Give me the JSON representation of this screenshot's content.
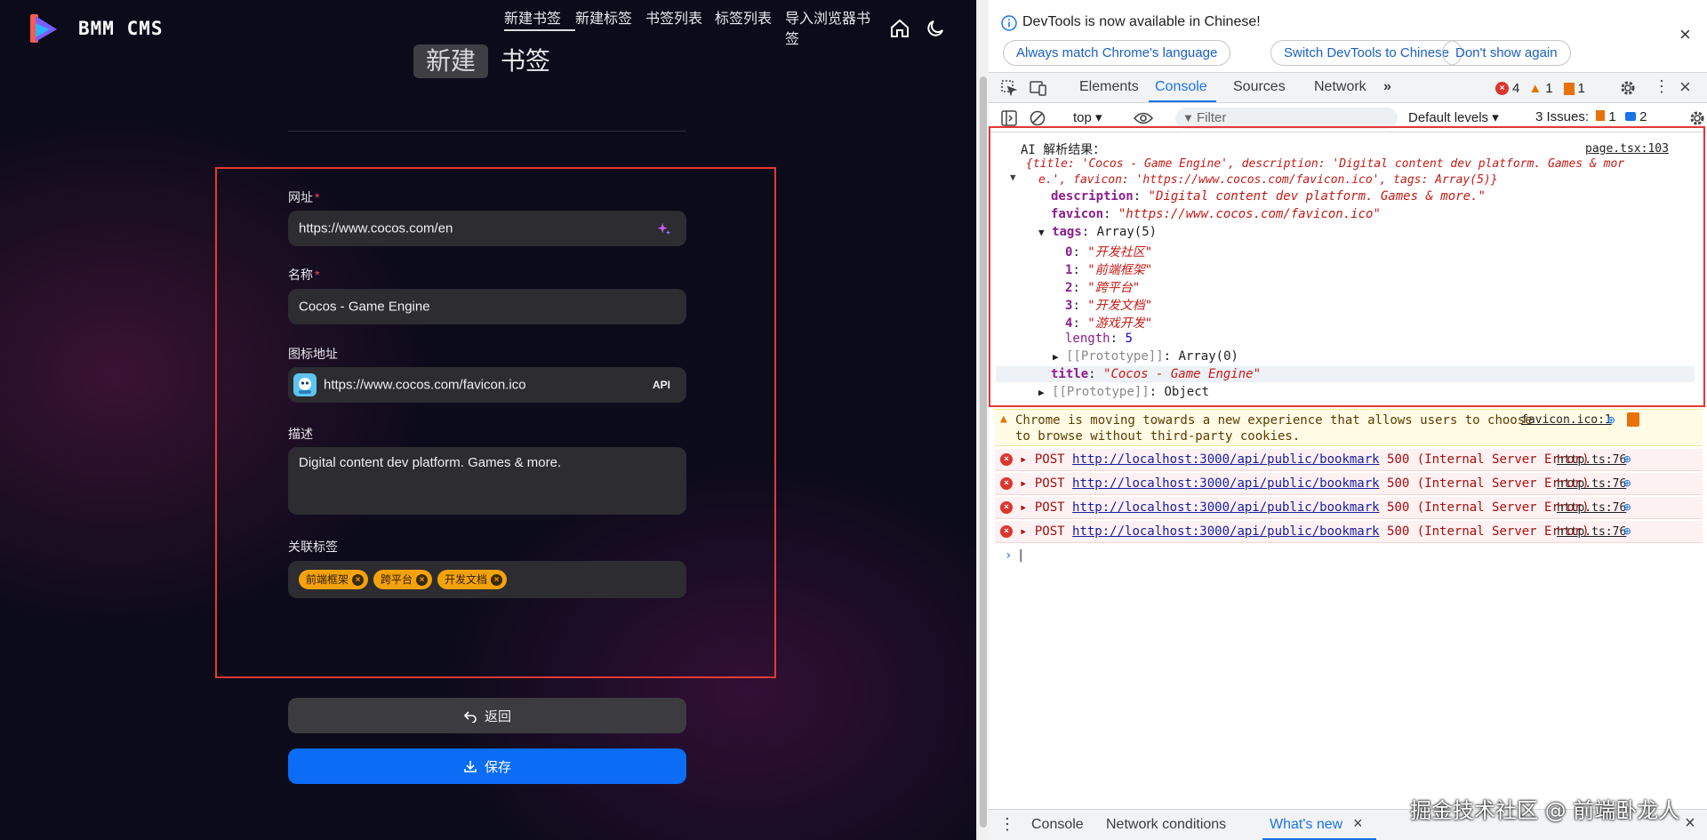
{
  "app": {
    "brand": "BMM CMS",
    "nav": [
      "新建书签",
      "新建标签",
      "书签列表",
      "标签列表",
      "导入浏览器书签"
    ],
    "heading": {
      "highlight": "新建",
      "rest": "书签"
    },
    "form": {
      "url_label": "网址",
      "url_value": "https://www.cocos.com/en",
      "name_label": "名称",
      "name_value": "Cocos - Game Engine",
      "icon_label": "图标地址",
      "icon_value": "https://www.cocos.com/favicon.ico",
      "icon_api": "API",
      "desc_label": "描述",
      "desc_value": "Digital content dev platform. Games & more.",
      "tags_label": "关联标签",
      "tags": [
        "前端框架",
        "跨平台",
        "开发文档"
      ],
      "required_mark": "*"
    },
    "back_label": "返回",
    "save_label": "保存"
  },
  "devtools": {
    "banner": {
      "title": "DevTools is now available in Chinese!",
      "buttons": [
        "Always match Chrome's language",
        "Switch DevTools to Chinese",
        "Don't show again"
      ]
    },
    "tabs": [
      "Elements",
      "Console",
      "Sources",
      "Network"
    ],
    "active_tab": "Console",
    "counts": {
      "errors": "4",
      "warnings": "1",
      "issues_badge": "1"
    },
    "filter": {
      "context": "top",
      "placeholder": "Filter",
      "levels": "Default levels",
      "issues_label": "3 Issues:",
      "issues_err": "1",
      "issues_info": "2"
    },
    "log": {
      "header": "AI 解析结果：",
      "source": "page.tsx:103",
      "preview_1": "{title: 'Cocos - Game Engine', description: 'Digital content dev platform. Games & mor",
      "preview_2": "e.', favicon: 'https://www.cocos.com/favicon.ico', tags: Array(5)}",
      "description_key": "description",
      "description_val": "\"Digital content dev platform. Games & more.\"",
      "favicon_key": "favicon",
      "favicon_val": "\"https://www.cocos.com/favicon.ico\"",
      "tags_key": "tags",
      "tags_type": "Array(5)",
      "tags": [
        "\"开发社区\"",
        "\"前端框架\"",
        "\"跨平台\"",
        "\"开发文档\"",
        "\"游戏开发\""
      ],
      "length_key": "length",
      "length_val": "5",
      "proto_array": "[[Prototype]]",
      "proto_array_val": "Array(0)",
      "title_key": "title",
      "title_val": "\"Cocos - Game Engine\"",
      "proto_obj": "[[Prototype]]",
      "proto_obj_val": "Object"
    },
    "warning": {
      "line1": "Chrome is moving towards a new experience that allows users to choose",
      "line2": "to browse without third-party cookies.",
      "source": "favicon.ico:1"
    },
    "errors": [
      {
        "method": "POST",
        "url": "http://localhost:3000/api/public/bookmark",
        "status": "500 (Internal Server Error)",
        "source": "http.ts:76"
      },
      {
        "method": "POST",
        "url": "http://localhost:3000/api/public/bookmark",
        "status": "500 (Internal Server Error)",
        "source": "http.ts:76"
      },
      {
        "method": "POST",
        "url": "http://localhost:3000/api/public/bookmark",
        "status": "500 (Internal Server Error)",
        "source": "http.ts:76"
      },
      {
        "method": "POST",
        "url": "http://localhost:3000/api/public/bookmark",
        "status": "500 (Internal Server Error)",
        "source": "http.ts:76"
      }
    ],
    "drawer_tabs": [
      "Console",
      "Network conditions",
      "What's new"
    ]
  },
  "watermark": "掘金技术社区 @ 前端卧龙人",
  "colors": {
    "accent_blue": "#0b6cf5",
    "tag_orange": "#f4a20c",
    "highlight_red": "#e53935"
  }
}
